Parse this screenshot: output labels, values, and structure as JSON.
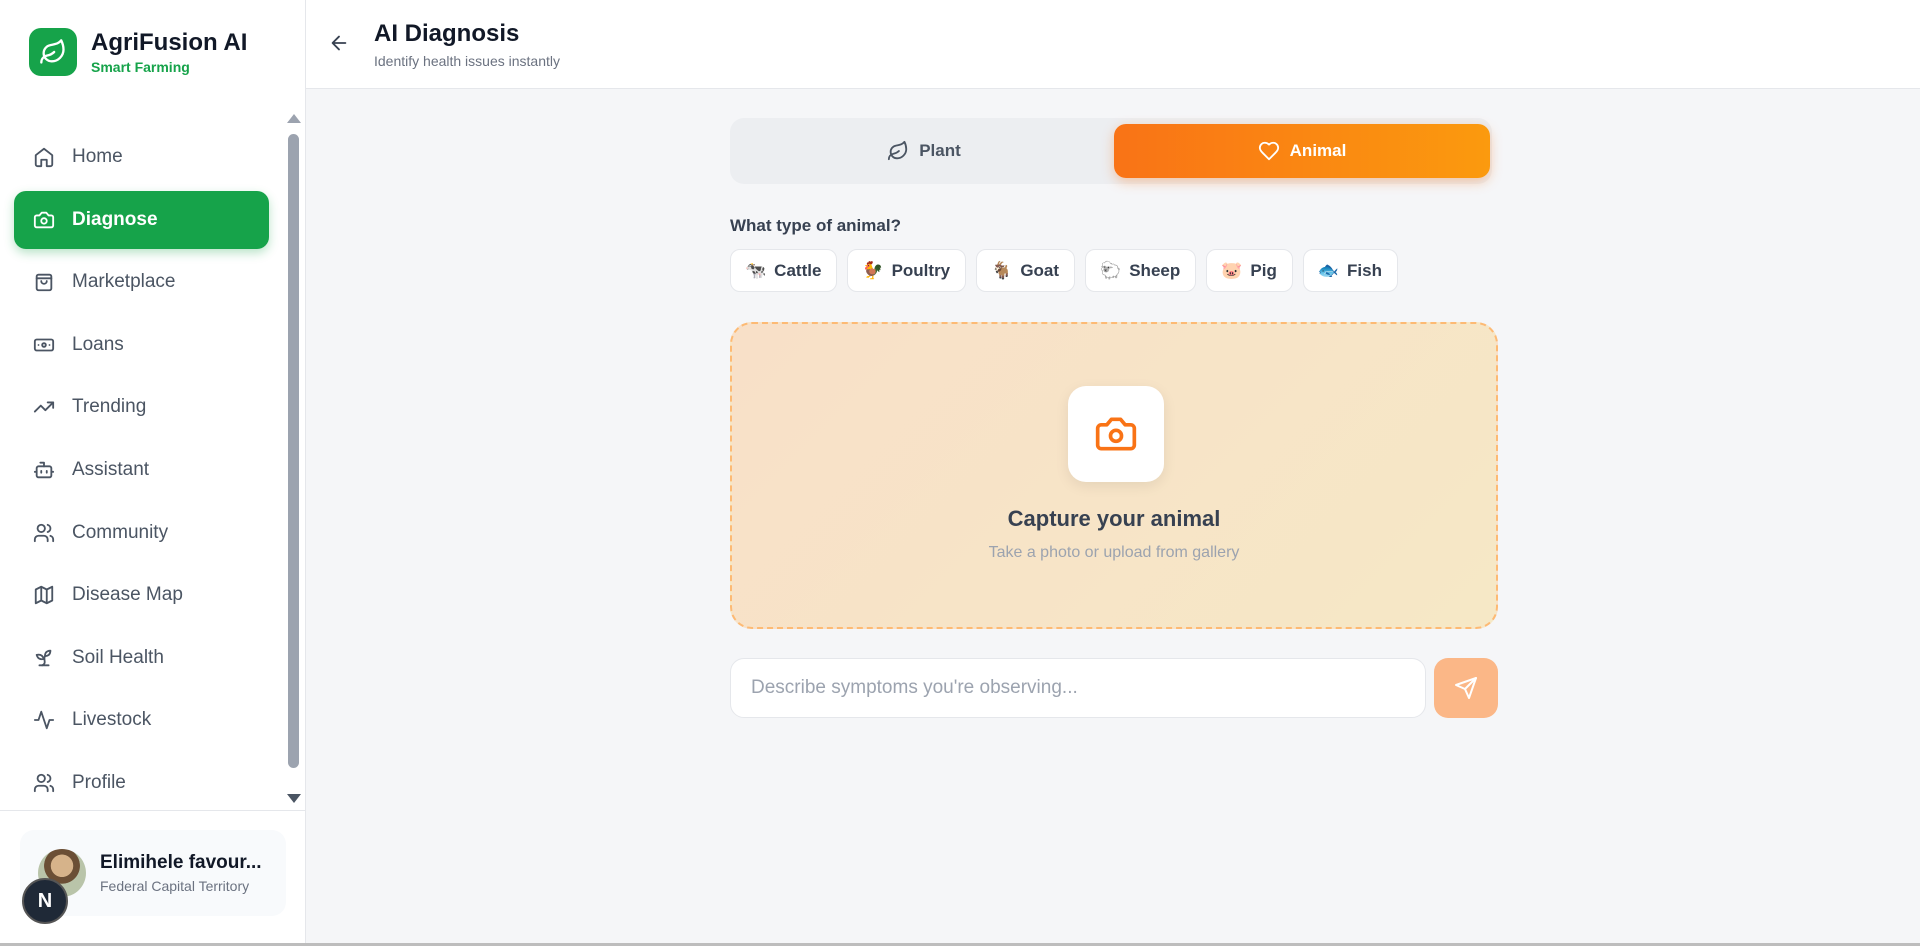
{
  "brand": {
    "name": "AgriFusion AI",
    "tagline": "Smart Farming"
  },
  "sidebar": {
    "items": [
      {
        "label": "Home",
        "icon": "home-icon",
        "active": false
      },
      {
        "label": "Diagnose",
        "icon": "camera-icon",
        "active": true
      },
      {
        "label": "Marketplace",
        "icon": "shopping-bag-icon",
        "active": false
      },
      {
        "label": "Loans",
        "icon": "banknote-icon",
        "active": false
      },
      {
        "label": "Trending",
        "icon": "trending-up-icon",
        "active": false
      },
      {
        "label": "Assistant",
        "icon": "bot-icon",
        "active": false
      },
      {
        "label": "Community",
        "icon": "users-icon",
        "active": false
      },
      {
        "label": "Disease Map",
        "icon": "map-icon",
        "active": false
      },
      {
        "label": "Soil Health",
        "icon": "sprout-icon",
        "active": false
      },
      {
        "label": "Livestock",
        "icon": "activity-icon",
        "active": false
      },
      {
        "label": "Profile",
        "icon": "users-icon",
        "active": false
      }
    ]
  },
  "user": {
    "name": "Elimihele favour...",
    "location": "Federal Capital Territory",
    "badge": "N"
  },
  "header": {
    "title": "AI Diagnosis",
    "subtitle": "Identify health issues instantly"
  },
  "toggle": {
    "plant_label": "Plant",
    "animal_label": "Animal",
    "selected": "Animal"
  },
  "animal_type": {
    "question": "What type of animal?",
    "options": [
      {
        "emoji": "🐄",
        "label": "Cattle"
      },
      {
        "emoji": "🐓",
        "label": "Poultry"
      },
      {
        "emoji": "🐐",
        "label": "Goat"
      },
      {
        "emoji": "🐑",
        "label": "Sheep"
      },
      {
        "emoji": "🐷",
        "label": "Pig"
      },
      {
        "emoji": "🐟",
        "label": "Fish"
      }
    ]
  },
  "capture": {
    "title": "Capture your animal",
    "subtitle": "Take a photo or upload from gallery"
  },
  "symptoms": {
    "placeholder": "Describe symptoms you're observing...",
    "value": ""
  },
  "colors": {
    "primary": "#16a34a",
    "accent": "#f97316",
    "accent_light": "#fbb787"
  }
}
